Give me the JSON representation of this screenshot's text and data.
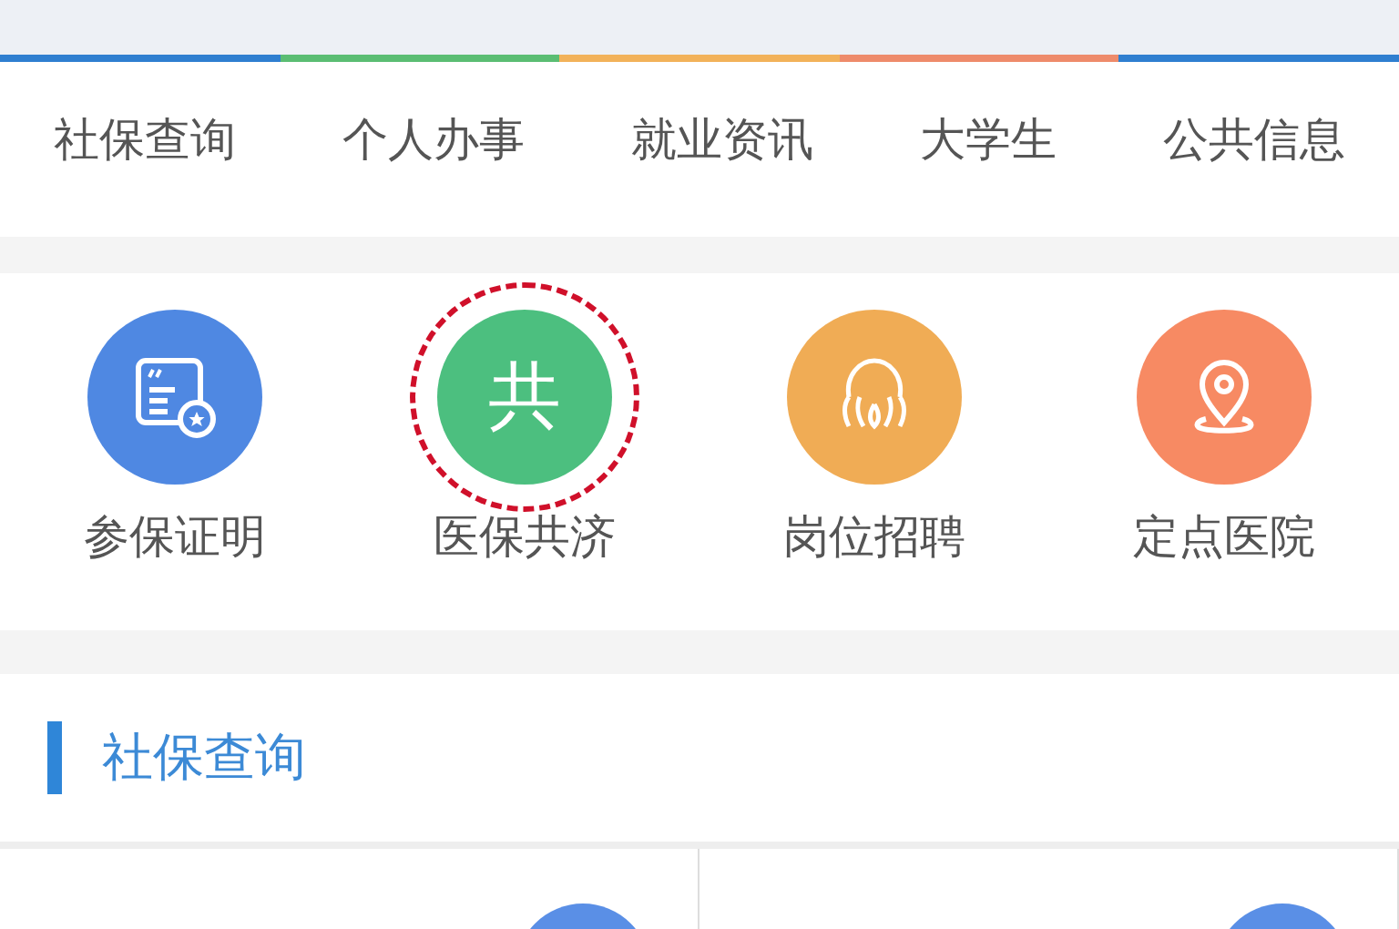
{
  "tabs": [
    {
      "label": "社保查询"
    },
    {
      "label": "个人办事"
    },
    {
      "label": "就业资讯"
    },
    {
      "label": "大学生"
    },
    {
      "label": "公共信息"
    }
  ],
  "services": [
    {
      "label": "参保证明",
      "kind": "certificate",
      "color": "#4f88e2",
      "highlighted": false
    },
    {
      "label": "医保共济",
      "kind": "glyph",
      "glyph": "共",
      "color": "#4cbf7f",
      "highlighted": true
    },
    {
      "label": "岗位招聘",
      "kind": "jobs",
      "color": "#f0ac55",
      "highlighted": false
    },
    {
      "label": "定点医院",
      "kind": "location",
      "color": "#f78a63",
      "highlighted": false
    }
  ],
  "section": {
    "title": "社保查询"
  }
}
